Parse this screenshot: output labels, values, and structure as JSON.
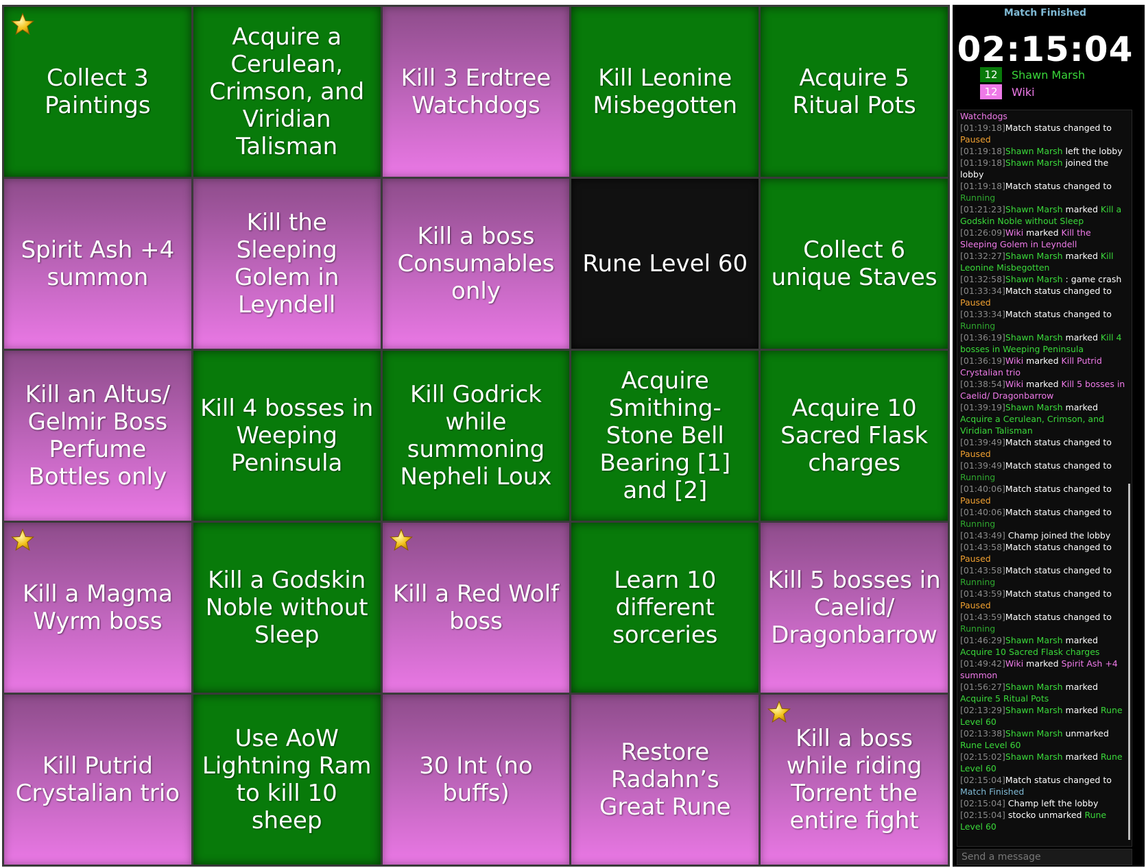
{
  "board": {
    "cells": [
      {
        "text": "Collect 3 Paintings",
        "color": "green",
        "star": true
      },
      {
        "text": "Acquire a Cerulean, Crimson, and Viridian Talisman",
        "color": "green",
        "star": false
      },
      {
        "text": "Kill 3 Erdtree Watchdogs",
        "color": "pink",
        "star": false
      },
      {
        "text": "Kill Leonine Misbegotten",
        "color": "green",
        "star": false
      },
      {
        "text": "Acquire 5 Ritual Pots",
        "color": "green",
        "star": false
      },
      {
        "text": "Spirit Ash +4 summon",
        "color": "pink",
        "star": false
      },
      {
        "text": "Kill the Sleeping Golem in Leyndell",
        "color": "pink",
        "star": false
      },
      {
        "text": "Kill a boss Consumables only",
        "color": "pink",
        "star": false
      },
      {
        "text": "Rune Level 60",
        "color": "black",
        "star": false
      },
      {
        "text": "Collect 6 unique Staves",
        "color": "green",
        "star": false
      },
      {
        "text": "Kill an Altus/ Gelmir Boss Perfume Bottles only",
        "color": "pink",
        "star": false
      },
      {
        "text": "Kill 4 bosses in Weeping Peninsula",
        "color": "green",
        "star": false
      },
      {
        "text": "Kill Godrick while summoning Nepheli Loux",
        "color": "green",
        "star": false
      },
      {
        "text": "Acquire Smithing-Stone Bell Bearing [1] and [2]",
        "color": "green",
        "star": false
      },
      {
        "text": "Acquire 10 Sacred Flask charges",
        "color": "green",
        "star": false
      },
      {
        "text": "Kill a Magma Wyrm boss",
        "color": "pink",
        "star": true
      },
      {
        "text": "Kill a Godskin Noble without Sleep",
        "color": "green",
        "star": false
      },
      {
        "text": "Kill a Red Wolf boss",
        "color": "pink",
        "star": true
      },
      {
        "text": "Learn 10 different sorceries",
        "color": "green",
        "star": false
      },
      {
        "text": "Kill 5 bosses in Caelid/ Dragonbarrow",
        "color": "pink",
        "star": false
      },
      {
        "text": "Kill Putrid Crystalian trio",
        "color": "pink",
        "star": false
      },
      {
        "text": "Use AoW Lightning Ram to kill 10 sheep",
        "color": "green",
        "star": false
      },
      {
        "text": "30 Int (no buffs)",
        "color": "pink",
        "star": false
      },
      {
        "text": "Restore Radahn’s Great Rune",
        "color": "pink",
        "star": false
      },
      {
        "text": "Kill a boss while riding Torrent the entire fight",
        "color": "pink",
        "star": true
      }
    ]
  },
  "sidebar": {
    "status": "Match Finished",
    "timer": "02:15:04",
    "players": [
      {
        "score": "12",
        "name": "Shawn Marsh",
        "color": "#087a0a",
        "text_color": "#3ad83a"
      },
      {
        "score": "12",
        "name": "Wiki",
        "color": "#ee7ae8",
        "text_color": "#ee7ae8"
      }
    ]
  },
  "chat": {
    "messages": [
      [
        [
          "pp",
          "Watchdogs"
        ]
      ],
      [
        [
          "ts",
          "[01:19:18]"
        ],
        [
          "",
          "Match status changed to "
        ],
        [
          "paused",
          "Paused"
        ]
      ],
      [
        [
          "ts",
          "[01:19:18]"
        ],
        [
          "pg",
          "Shawn Marsh"
        ],
        [
          "",
          " left the lobby"
        ]
      ],
      [
        [
          "ts",
          "[01:19:18]"
        ],
        [
          "pg",
          "Shawn Marsh"
        ],
        [
          "",
          " joined the lobby"
        ]
      ],
      [
        [
          "ts",
          "[01:19:18]"
        ],
        [
          "",
          "Match status changed to "
        ],
        [
          "running",
          "Running"
        ]
      ],
      [
        [
          "ts",
          "[01:21:23]"
        ],
        [
          "pg",
          "Shawn Marsh"
        ],
        [
          "",
          " marked "
        ],
        [
          "pg",
          "Kill a Godskin Noble without Sleep"
        ]
      ],
      [
        [
          "ts",
          "[01:26:09]"
        ],
        [
          "pp",
          "Wiki"
        ],
        [
          "",
          " marked "
        ],
        [
          "pp",
          "Kill the Sleeping Golem in Leyndell"
        ]
      ],
      [
        [
          "ts",
          "[01:32:27]"
        ],
        [
          "pg",
          "Shawn Marsh"
        ],
        [
          "",
          " marked "
        ],
        [
          "pg",
          "Kill Leonine Misbegotten"
        ]
      ],
      [
        [
          "ts",
          "[01:32:58]"
        ],
        [
          "pg",
          "Shawn Marsh"
        ],
        [
          "",
          " : game crash"
        ]
      ],
      [
        [
          "ts",
          "[01:33:34]"
        ],
        [
          "",
          "Match status changed to "
        ],
        [
          "paused",
          "Paused"
        ]
      ],
      [
        [
          "ts",
          "[01:33:34]"
        ],
        [
          "",
          "Match status changed to "
        ],
        [
          "running",
          "Running"
        ]
      ],
      [
        [
          "ts",
          "[01:36:19]"
        ],
        [
          "pg",
          "Shawn Marsh"
        ],
        [
          "",
          " marked "
        ],
        [
          "pg",
          "Kill 4 bosses in Weeping Peninsula"
        ]
      ],
      [
        [
          "ts",
          "[01:36:19]"
        ],
        [
          "pp",
          "Wiki"
        ],
        [
          "",
          " marked "
        ],
        [
          "pp",
          "Kill Putrid Crystalian trio"
        ]
      ],
      [
        [
          "ts",
          "[01:38:54]"
        ],
        [
          "pp",
          "Wiki"
        ],
        [
          "",
          " marked "
        ],
        [
          "pp",
          "Kill 5 bosses in Caelid/ Dragonbarrow"
        ]
      ],
      [
        [
          "ts",
          "[01:39:19]"
        ],
        [
          "pg",
          "Shawn Marsh"
        ],
        [
          "",
          " marked "
        ],
        [
          "pg",
          "Acquire a Cerulean, Crimson, and Viridian Talisman"
        ]
      ],
      [
        [
          "ts",
          "[01:39:49]"
        ],
        [
          "",
          "Match status changed to "
        ],
        [
          "paused",
          "Paused"
        ]
      ],
      [
        [
          "ts",
          "[01:39:49]"
        ],
        [
          "",
          "Match status changed to "
        ],
        [
          "running",
          "Running"
        ]
      ],
      [
        [
          "ts",
          "[01:40:06]"
        ],
        [
          "",
          "Match status changed to "
        ],
        [
          "paused",
          "Paused"
        ]
      ],
      [
        [
          "ts",
          "[01:40:06]"
        ],
        [
          "",
          "Match status changed to "
        ],
        [
          "running",
          "Running"
        ]
      ],
      [
        [
          "ts",
          "[01:43:49]"
        ],
        [
          "",
          " Champ joined the lobby"
        ]
      ],
      [
        [
          "ts",
          "[01:43:58]"
        ],
        [
          "",
          "Match status changed to "
        ],
        [
          "paused",
          "Paused"
        ]
      ],
      [
        [
          "ts",
          "[01:43:58]"
        ],
        [
          "",
          "Match status changed to "
        ],
        [
          "running",
          "Running"
        ]
      ],
      [
        [
          "ts",
          "[01:43:59]"
        ],
        [
          "",
          "Match status changed to "
        ],
        [
          "paused",
          "Paused"
        ]
      ],
      [
        [
          "ts",
          "[01:43:59]"
        ],
        [
          "",
          "Match status changed to "
        ],
        [
          "running",
          "Running"
        ]
      ],
      [
        [
          "ts",
          "[01:46:29]"
        ],
        [
          "pg",
          "Shawn Marsh"
        ],
        [
          "",
          " marked "
        ],
        [
          "pg",
          "Acquire 10 Sacred Flask charges"
        ]
      ],
      [
        [
          "ts",
          "[01:49:42]"
        ],
        [
          "pp",
          "Wiki"
        ],
        [
          "",
          " marked "
        ],
        [
          "pp",
          "Spirit Ash +4 summon"
        ]
      ],
      [
        [
          "ts",
          "[01:56:27]"
        ],
        [
          "pg",
          "Shawn Marsh"
        ],
        [
          "",
          " marked "
        ],
        [
          "pg",
          "Acquire 5 Ritual Pots"
        ]
      ],
      [
        [
          "ts",
          "[02:13:29]"
        ],
        [
          "pg",
          "Shawn Marsh"
        ],
        [
          "",
          " marked "
        ],
        [
          "pg",
          "Rune Level 60"
        ]
      ],
      [
        [
          "ts",
          "[02:13:38]"
        ],
        [
          "pg",
          "Shawn Marsh"
        ],
        [
          "",
          " unmarked "
        ],
        [
          "pg",
          "Rune Level 60"
        ]
      ],
      [
        [
          "ts",
          "[02:15:02]"
        ],
        [
          "pg",
          "Shawn Marsh"
        ],
        [
          "",
          " marked "
        ],
        [
          "pg",
          "Rune Level 60"
        ]
      ],
      [
        [
          "ts",
          "[02:15:04]"
        ],
        [
          "",
          "Match status changed to "
        ],
        [
          "finished",
          "Match Finished"
        ]
      ],
      [
        [
          "ts",
          "[02:15:04]"
        ],
        [
          "",
          " Champ left the lobby"
        ]
      ],
      [
        [
          "ts",
          "[02:15:04]"
        ],
        [
          "",
          " stocko unmarked "
        ],
        [
          "pg",
          "Rune Level 60"
        ]
      ]
    ],
    "input_placeholder": "Send a message"
  }
}
